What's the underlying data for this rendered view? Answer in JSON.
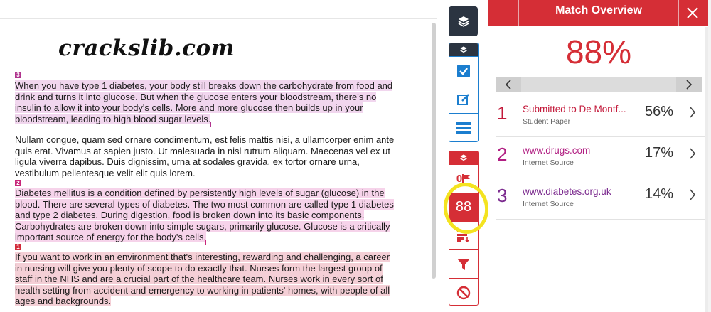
{
  "document": {
    "watermark": "crackslib.com",
    "paragraphs": [
      {
        "marker": "3",
        "text": "When you have type 1 diabetes, your body still breaks down the carbohydrate from food and drink and turns it into glucose. But when the glucose enters your bloodstream, there's no insulin to allow it into your body's cells. More and more glucose then builds up in your bloodstream, leading to high blood sugar levels."
      },
      {
        "marker": "",
        "text": "Nullam congue, quam sed ornare condimentum, est felis mattis nisi, a ullamcorper enim ante quis erat. Vivamus at sapien justo. Ut malesuada in nisl rutrum aliquam. Maecenas vel ex ut ligula viverra dapibus. Duis dignissim, urna at sodales gravida, ex tortor ornare urna, vestibulum pellentesque velit elit quis lorem."
      },
      {
        "marker": "2",
        "text": "Diabetes mellitus is a condition defined by persistently high levels of sugar (glucose) in the blood. There are several types of diabetes. The two most common are called type 1 diabetes and type 2 diabetes. During digestion, food is broken down into its basic components. Carbohydrates are broken down into simple sugars, primarily glucose. Glucose is a critically important source of energy for the body's cells."
      },
      {
        "marker": "1",
        "text": "If you want to work in an environment that's interesting, rewarding and challenging, a career in nursing will give you plenty of scope to do exactly that. Nurses form the largest group of staff in the NHS and are a crucial part of the healthcare team. Nurses work in every sort of health setting from accident and emergency to working in patients' homes, with people of all ages and backgrounds."
      }
    ]
  },
  "rail": {
    "flag_count": "0",
    "score": "88"
  },
  "panel": {
    "title": "Match Overview",
    "overall_score": "88%",
    "sources": [
      {
        "rank": "1",
        "name": "Submitted to De Montf...",
        "type": "Student Paper",
        "percent": "56%",
        "color": "#c3193a"
      },
      {
        "rank": "2",
        "name": "www.drugs.com",
        "type": "Internet Source",
        "percent": "17%",
        "color": "#b11e82"
      },
      {
        "rank": "3",
        "name": "www.diabetes.org.uk",
        "type": "Internet Source",
        "percent": "14%",
        "color": "#7b2a8e"
      }
    ]
  },
  "colors": {
    "accent_red": "#d52e36",
    "rail_dark": "#2b3441",
    "rail_blue": "#1b7ecf",
    "highlight_yellow": "#f4e320"
  },
  "icons": {
    "layers": "layers-icon",
    "checkbox": "checkbox-icon",
    "edit": "edit-icon",
    "grid": "grid-icon",
    "flag": "flag-icon",
    "sort": "sort-bars-icon",
    "filter": "filter-icon",
    "exclude": "no-entry-icon",
    "close": "close-icon",
    "chevron_left": "chevron-left-icon",
    "chevron_right": "chevron-right-icon"
  }
}
